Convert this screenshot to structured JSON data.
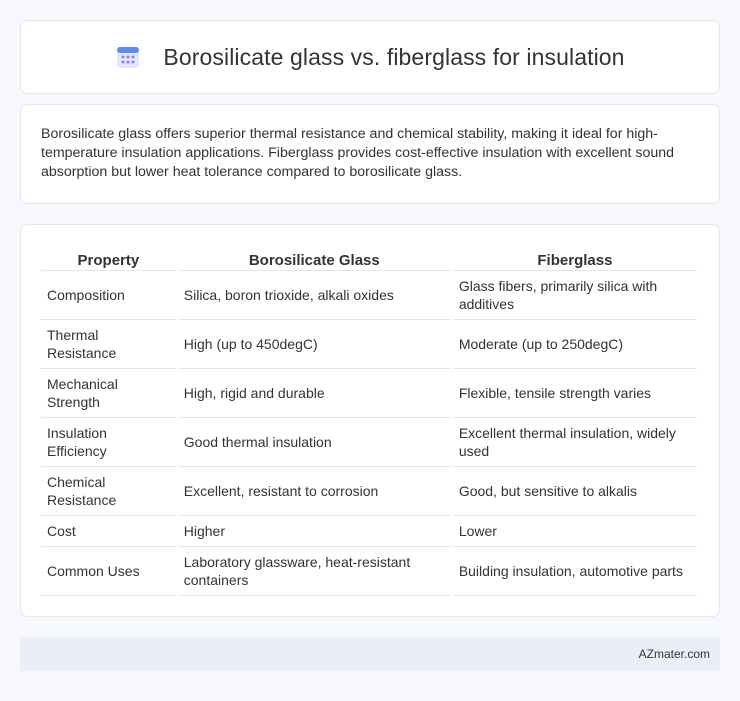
{
  "header": {
    "title": "Borosilicate glass vs. fiberglass for insulation",
    "icon": "calendar-icon"
  },
  "summary": {
    "text": "Borosilicate glass offers superior thermal resistance and chemical stability, making it ideal for high-temperature insulation applications. Fiberglass provides cost-effective insulation with excellent sound absorption but lower heat tolerance compared to borosilicate glass."
  },
  "table": {
    "headers": [
      "Property",
      "Borosilicate Glass",
      "Fiberglass"
    ],
    "rows": [
      [
        "Composition",
        "Silica, boron trioxide, alkali oxides",
        "Glass fibers, primarily silica with additives"
      ],
      [
        "Thermal Resistance",
        "High (up to 450degC)",
        "Moderate (up to 250degC)"
      ],
      [
        "Mechanical Strength",
        "High, rigid and durable",
        "Flexible, tensile strength varies"
      ],
      [
        "Insulation Efficiency",
        "Good thermal insulation",
        "Excellent thermal insulation, widely used"
      ],
      [
        "Chemical Resistance",
        "Excellent, resistant to corrosion",
        "Good, but sensitive to alkalis"
      ],
      [
        "Cost",
        "Higher",
        "Lower"
      ],
      [
        "Common Uses",
        "Laboratory glassware, heat-resistant containers",
        "Building insulation, automotive parts"
      ]
    ]
  },
  "footer": {
    "brand": "AZmater.com"
  },
  "colors": {
    "icon_blue": "#5b8def",
    "icon_purple": "#8e7cf0",
    "border": "#e3e6ee",
    "footer_bg": "#eaeef7"
  }
}
